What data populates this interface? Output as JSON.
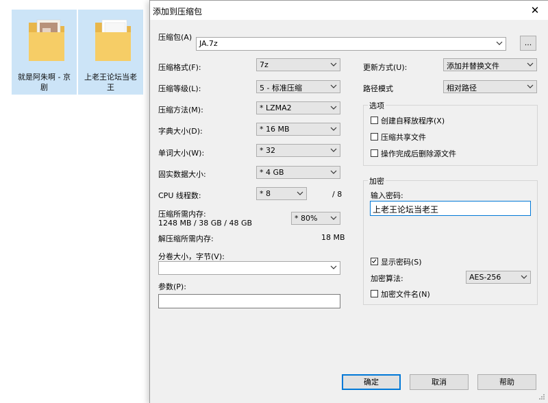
{
  "desktop": {
    "items": [
      {
        "label_line1": "就是阿朱啊 - 京",
        "label_line2": "剧"
      },
      {
        "label_line1": "上老王论坛当老",
        "label_line2": "王"
      }
    ]
  },
  "dialog": {
    "title": "添加到压缩包",
    "archive": {
      "label": "压缩包(A)",
      "value": "JA.7z",
      "browse_label": "..."
    },
    "left": {
      "format_label": "压缩格式(F):",
      "format_value": "7z",
      "level_label": "压缩等级(L):",
      "level_value": "5 - 标准压缩",
      "method_label": "压缩方法(M):",
      "method_value": "* LZMA2",
      "dict_label": "字典大小(D):",
      "dict_value": "* 16 MB",
      "word_label": "单词大小(W):",
      "word_value": "* 32",
      "solid_label": "固实数据大小:",
      "solid_value": "* 4 GB",
      "cpu_label": "CPU 线程数:",
      "cpu_value": "* 8",
      "cpu_total": "/ 8",
      "mem_label": "压缩所需内存:",
      "mem_detail": "1248 MB / 38 GB / 48 GB",
      "mem_percent": "* 80%",
      "decomp_label": "解压缩所需内存:",
      "decomp_value": "18 MB",
      "split_label": "分卷大小，字节(V):",
      "split_value": "",
      "params_label": "参数(P):",
      "params_value": ""
    },
    "right": {
      "update_label": "更新方式(U):",
      "update_value": "添加并替换文件",
      "path_label": "路径模式",
      "path_value": "相对路径",
      "options_title": "选项",
      "opt_sfx": "创建自释放程序(X)",
      "opt_shared": "压缩共享文件",
      "opt_delete": "操作完成后删除源文件",
      "encrypt_title": "加密",
      "password_label": "输入密码:",
      "password_value": "上老王论坛当老王",
      "show_password": "显示密码(S)",
      "algo_label": "加密算法:",
      "algo_value": "AES-256",
      "encrypt_names": "加密文件名(N)"
    },
    "buttons": {
      "ok": "确定",
      "cancel": "取消",
      "help": "帮助"
    }
  }
}
